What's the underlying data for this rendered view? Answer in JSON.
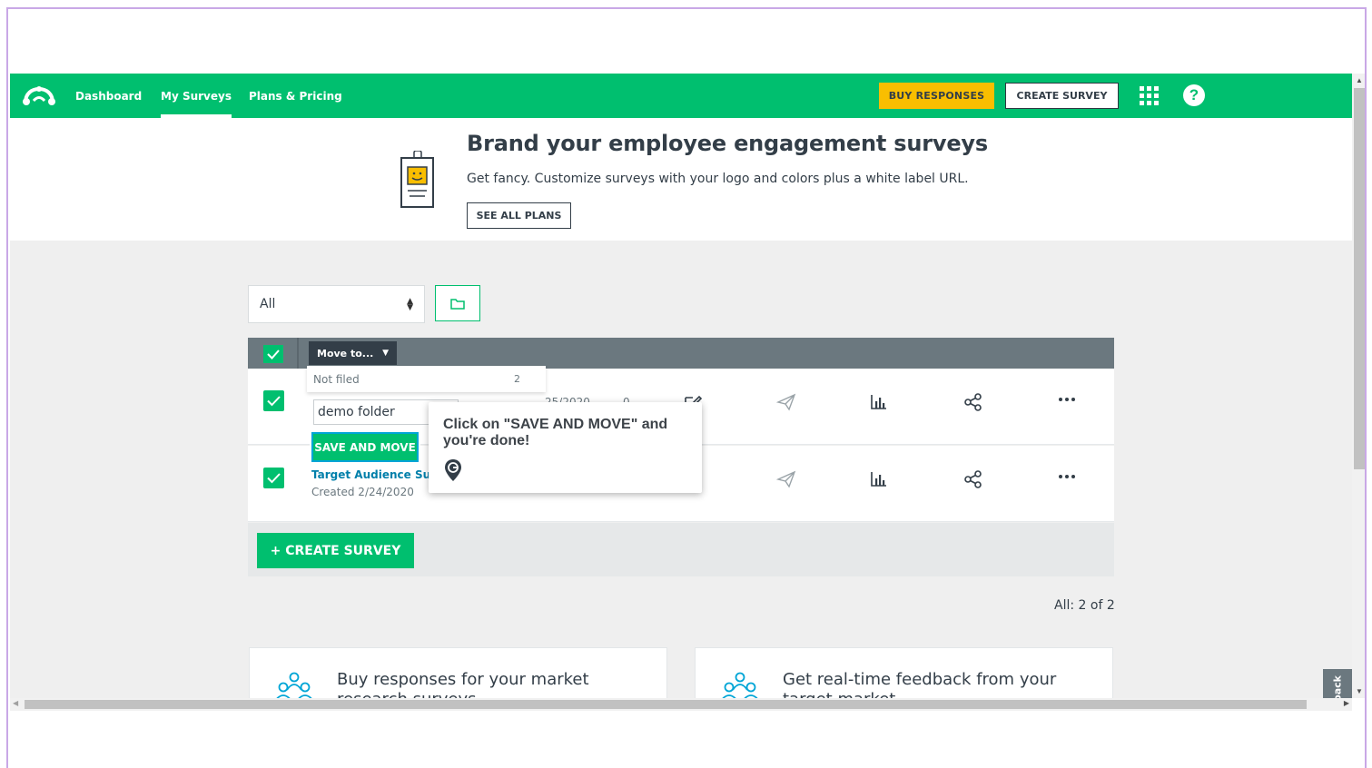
{
  "nav": {
    "links": [
      "Dashboard",
      "My Surveys",
      "Plans & Pricing"
    ],
    "buy_responses": "BUY RESPONSES",
    "create_survey": "CREATE SURVEY",
    "help": "?"
  },
  "banner": {
    "title": "Brand your employee engagement surveys",
    "text": "Get fancy. Customize surveys with your logo and colors plus a white label URL.",
    "button": "SEE ALL PLANS"
  },
  "filter": {
    "selected": "All"
  },
  "table": {
    "move_to": "Move to...",
    "rows": [
      {
        "date": "25/2020",
        "responses": "0"
      },
      {
        "title": "Target Audience Surve",
        "created": "Created 2/24/2020"
      }
    ]
  },
  "dropdown": {
    "item_label": "Not filed",
    "item_count": "2",
    "input_value": "demo folder",
    "save_button": "SAVE AND MOVE"
  },
  "tooltip": {
    "text": "Click on \"SAVE AND MOVE\" and you're done!"
  },
  "create_button": "+ CREATE SURVEY",
  "count_text": "All: 2 of 2",
  "promos": [
    {
      "text": "Buy responses for your market research surveys"
    },
    {
      "text": "Get real-time feedback from your target market"
    }
  ],
  "feedback": "Feedback",
  "colors": {
    "brand_green": "#00bf6f",
    "buy_yellow": "#f9be00",
    "header_gray": "#6b787f"
  }
}
